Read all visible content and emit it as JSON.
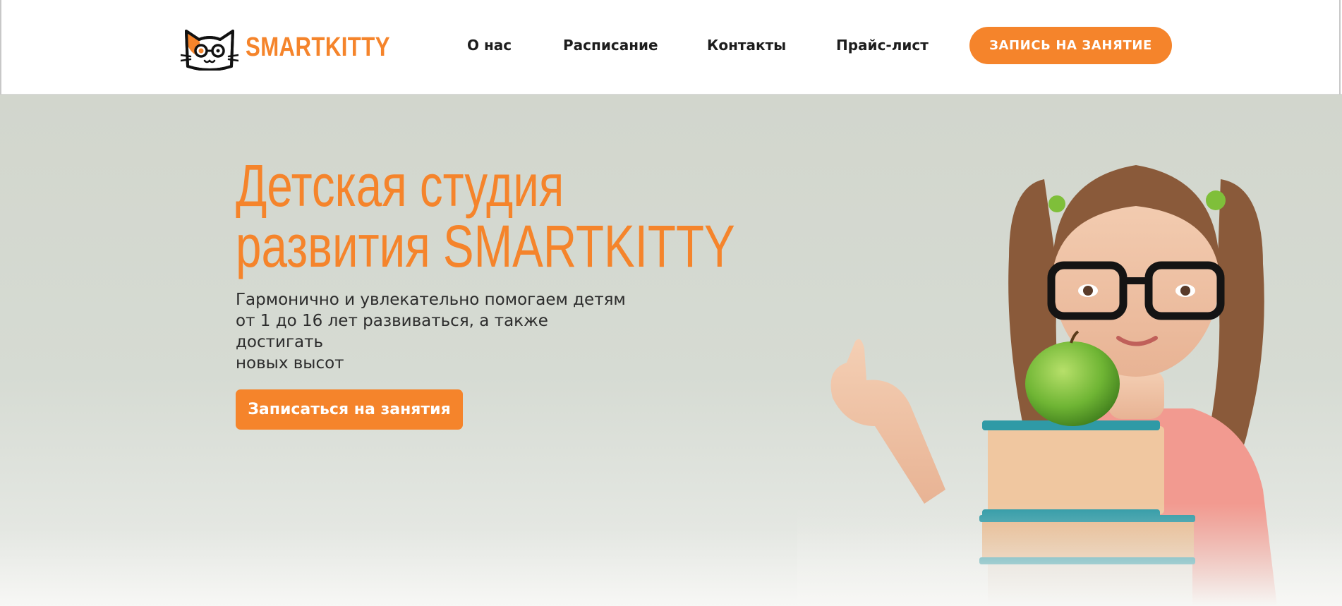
{
  "header": {
    "logo_text": "SMARTKITTY",
    "nav": [
      {
        "label": "О нас"
      },
      {
        "label": "Расписание"
      },
      {
        "label": "Контакты"
      },
      {
        "label": "Прайс-лист"
      }
    ],
    "cta_label": "ЗАПИСЬ НА ЗАНЯТИЕ"
  },
  "hero": {
    "title_line1": "Детская студия",
    "title_line2": "развития SMARTKITTY",
    "subtitle_line1": "Гармонично и увлекательно помогаем детям",
    "subtitle_line2": "от 1 до 16 лет развиваться, а также достигать",
    "subtitle_line3": "новых высот",
    "button_label": "Записаться на занятия"
  },
  "colors": {
    "accent": "#f5842b",
    "hero_bg": "#d4d8cf",
    "text_dark": "#1d1d1d"
  },
  "icons": {
    "logo": "cat-with-glasses-icon"
  }
}
